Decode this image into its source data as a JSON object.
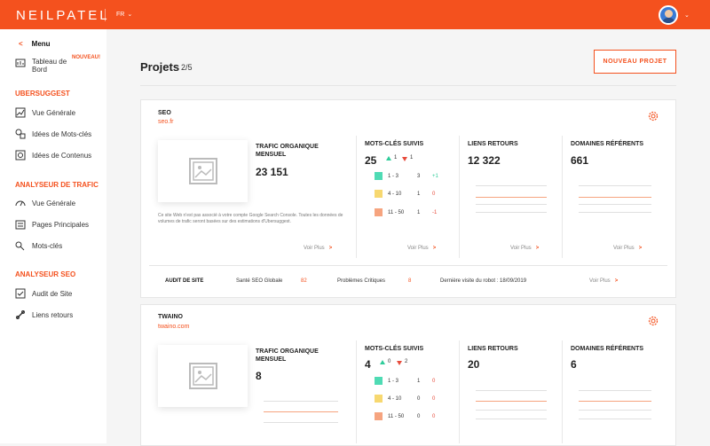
{
  "header": {
    "logo": "NEILPATEL",
    "language": "FR"
  },
  "sidebar": {
    "back_label": "Menu",
    "dashboard_label": "Tableau de Bord",
    "new_badge": "NOUVEAU!",
    "sections": [
      {
        "title": "UBERSUGGEST",
        "items": [
          "Vue Générale",
          "Idées de Mots-clés",
          "Idées de Contenus"
        ]
      },
      {
        "title": "ANALYSEUR DE TRAFIC",
        "items": [
          "Vue Générale",
          "Pages Principales",
          "Mots-clés"
        ]
      },
      {
        "title": "ANALYSEUR SEO",
        "items": [
          "Audit de Site",
          "Liens retours"
        ]
      }
    ]
  },
  "main": {
    "title": "Projets",
    "count": "2/5",
    "new_project_label": "NOUVEAU PROJET"
  },
  "colors": {
    "accent": "#f4511e",
    "green": "#2ecc9a",
    "red": "#e74c3c",
    "rank1": "#4fdbb4",
    "rank2": "#f7d870",
    "rank3": "#f6a47f"
  },
  "projects": [
    {
      "name": "SEO",
      "url": "seo.fr",
      "traffic_title": "TRAFIC ORGANIQUE MENSUEL",
      "traffic_value": "23 151",
      "note": "Ce site Web n'est pas associé à votre compte Google Search Console. Toutes les données de volumes de trafic seront basées sur des estimations d'Ubersuggest.",
      "keywords_title": "MOTS-CLÉS SUIVIS",
      "keywords_value": "25",
      "up": "1",
      "down": "1",
      "ranks": [
        {
          "range": "1 - 3",
          "count": "3",
          "delta": "+1"
        },
        {
          "range": "4 - 10",
          "count": "1",
          "delta": "0"
        },
        {
          "range": "11 - 50",
          "count": "1",
          "delta": "-1"
        }
      ],
      "backlinks_title": "LIENS RETOURS",
      "backlinks_value": "12 322",
      "domains_title": "DOMAINES RÉFÉRENTS",
      "domains_value": "661",
      "see_more": "Voir Plus",
      "audit": {
        "label": "AUDIT DE SITE",
        "health_label": "Santé SEO Globale",
        "health_value": "82",
        "issues_label": "Problèmes Critiques",
        "issues_value": "8",
        "last_visit": "Dernière visite du robot : 18/09/2019",
        "see_more": "Voir Plus"
      }
    },
    {
      "name": "TWAINO",
      "url": "twaino.com",
      "traffic_title": "TRAFIC ORGANIQUE MENSUEL",
      "traffic_value": "8",
      "keywords_title": "MOTS-CLÉS SUIVIS",
      "keywords_value": "4",
      "up": "0",
      "down": "2",
      "ranks": [
        {
          "range": "1 - 3",
          "count": "1",
          "delta": "0"
        },
        {
          "range": "4 - 10",
          "count": "0",
          "delta": "0"
        },
        {
          "range": "11 - 50",
          "count": "0",
          "delta": "0"
        }
      ],
      "backlinks_title": "LIENS RETOURS",
      "backlinks_value": "20",
      "domains_title": "DOMAINES RÉFÉRENTS",
      "domains_value": "6"
    }
  ]
}
